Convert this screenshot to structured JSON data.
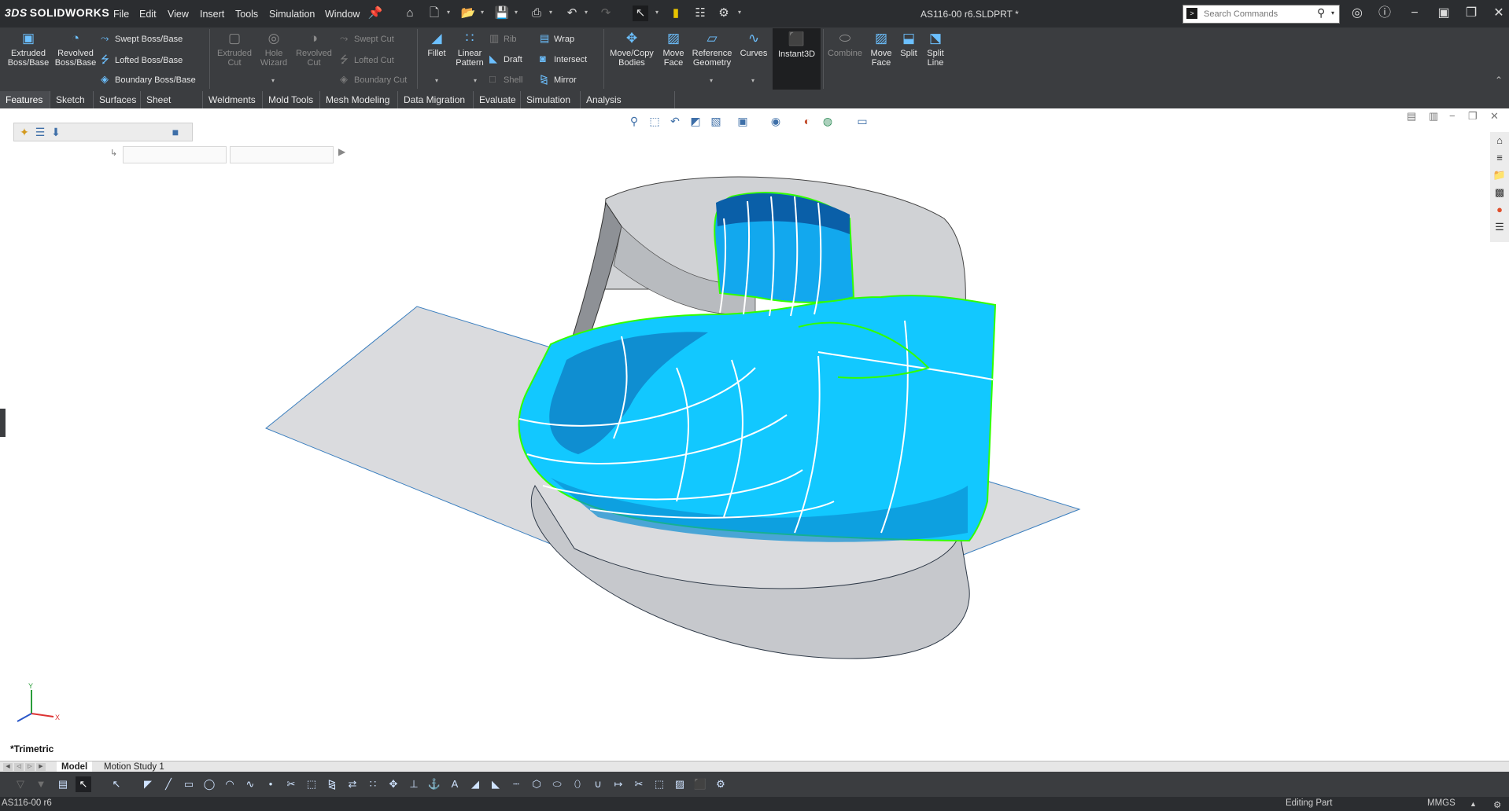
{
  "app": {
    "name": "SOLIDWORKS",
    "logo_mark": "3DS",
    "document_title": "AS116-00 r6.SLDPRT *"
  },
  "menu": [
    "File",
    "Edit",
    "View",
    "Insert",
    "Tools",
    "Simulation",
    "Window"
  ],
  "quick_access": [
    "pin-icon",
    "home-icon",
    "new-file-icon",
    "open-file-icon",
    "save-icon",
    "print-icon",
    "undo-icon",
    "redo-icon",
    "select-icon",
    "rebuild-icon",
    "file-properties-icon",
    "options-icon"
  ],
  "search": {
    "placeholder": "Search Commands"
  },
  "window_controls": [
    "user-icon",
    "help-icon",
    "minimize-icon",
    "restore-icon",
    "maximize-icon",
    "close-icon"
  ],
  "ribbon": {
    "large_buttons": [
      {
        "label1": "Extruded",
        "label2": "Boss/Base",
        "enabled": true
      },
      {
        "label1": "Revolved",
        "label2": "Boss/Base",
        "enabled": true
      },
      {
        "label1": "Extruded",
        "label2": "Cut",
        "enabled": false
      },
      {
        "label1": "Hole",
        "label2": "Wizard",
        "enabled": false
      },
      {
        "label1": "Revolved",
        "label2": "Cut",
        "enabled": false
      },
      {
        "label1": "Fillet",
        "label2": "",
        "enabled": true
      },
      {
        "label1": "Linear",
        "label2": "Pattern",
        "enabled": true
      },
      {
        "label1": "Move/Copy",
        "label2": "Bodies",
        "enabled": true
      },
      {
        "label1": "Move",
        "label2": "Face",
        "enabled": true
      },
      {
        "label1": "Reference",
        "label2": "Geometry",
        "enabled": true
      },
      {
        "label1": "Curves",
        "label2": "",
        "enabled": true
      },
      {
        "label1": "Instant3D",
        "label2": "",
        "enabled": true
      },
      {
        "label1": "Combine",
        "label2": "",
        "enabled": false
      },
      {
        "label1": "Move",
        "label2": "Face",
        "enabled": true
      },
      {
        "label1": "Split",
        "label2": "",
        "enabled": true
      },
      {
        "label1": "Split",
        "label2": "Line",
        "enabled": true
      }
    ],
    "small_buttons": [
      {
        "label": "Swept Boss/Base",
        "enabled": true
      },
      {
        "label": "Lofted Boss/Base",
        "enabled": true
      },
      {
        "label": "Boundary Boss/Base",
        "enabled": true
      },
      {
        "label": "Swept Cut",
        "enabled": false
      },
      {
        "label": "Lofted Cut",
        "enabled": false
      },
      {
        "label": "Boundary Cut",
        "enabled": false
      },
      {
        "label": "Rib",
        "enabled": false
      },
      {
        "label": "Draft",
        "enabled": true
      },
      {
        "label": "Shell",
        "enabled": false
      },
      {
        "label": "Wrap",
        "enabled": true
      },
      {
        "label": "Intersect",
        "enabled": true
      },
      {
        "label": "Mirror",
        "enabled": true
      }
    ]
  },
  "command_tabs": [
    "Features",
    "Sketch",
    "Surfaces",
    "Sheet Metal",
    "Weldments",
    "Mold Tools",
    "Mesh Modeling",
    "Data Migration",
    "Evaluate",
    "Simulation",
    "Analysis Preparation"
  ],
  "active_command_tab": "Features",
  "heads_up_toolbar": [
    "zoom-to-fit-icon",
    "zoom-to-area-icon",
    "previous-view-icon",
    "section-view-icon",
    "dynamic-annotation-icon",
    "view-orientation-icon",
    "display-style-icon",
    "hide-show-items-icon",
    "edit-appearance-icon",
    "apply-scene-icon",
    "view-settings-icon"
  ],
  "task_pane": [
    "home-icon",
    "design-library-icon",
    "file-explorer-icon",
    "view-palette-icon",
    "appearances-icon",
    "custom-properties-icon"
  ],
  "triad": {
    "y": "Y",
    "x": "X"
  },
  "view": {
    "orientation": "*Trimetric"
  },
  "bottom_tabs": [
    "Model",
    "Motion Study 1"
  ],
  "active_bottom_tab": "Model",
  "status": {
    "document": "AS116-00 r6",
    "mode": "Editing Part",
    "units": "MMGS"
  },
  "colors": {
    "surface_blue": "#12c8ff",
    "surface_dark_blue": "#0a5fa8",
    "reference_gray": "#d3d5d8",
    "edge_green": "#31ff00",
    "ui_dark": "#2b2d30",
    "ui_ribbon": "#3b3d40"
  }
}
